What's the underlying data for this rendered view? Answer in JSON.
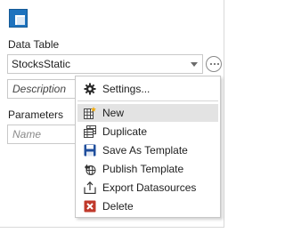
{
  "panel": {
    "data_table_label": "Data Table",
    "data_table_value": "StocksStatic",
    "description_placeholder": "Description",
    "parameters_label": "Parameters",
    "name_placeholder": "Name"
  },
  "menu": {
    "settings": "Settings...",
    "new": "New",
    "duplicate": "Duplicate",
    "save_as_template": "Save As Template",
    "publish_template": "Publish Template",
    "export_datasources": "Export Datasources",
    "delete": "Delete"
  },
  "colors": {
    "app_icon": "#1e73be",
    "highlight": "#e3e3e3",
    "delete_red": "#c0392b",
    "save_blue": "#1f4e9c"
  }
}
